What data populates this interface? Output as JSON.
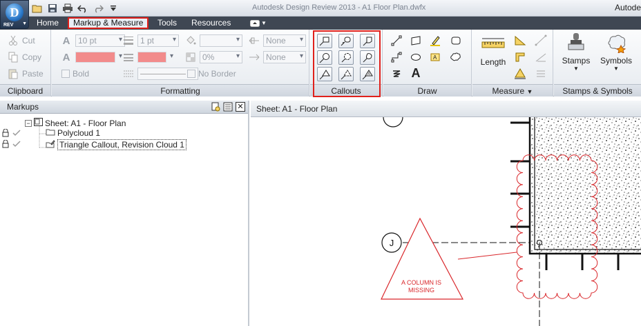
{
  "app": {
    "logo_letter": "D",
    "logo_sub": "REV",
    "title": "Autodesk Design Review 2013 - A1 Floor Plan.dwfx",
    "brand": "Autode"
  },
  "ribbon_tabs": [
    "Home",
    "Markup & Measure",
    "Tools",
    "Resources"
  ],
  "clipboard": {
    "cut": "Cut",
    "copy": "Copy",
    "paste": "Paste",
    "title": "Clipboard"
  },
  "formatting": {
    "font_size": "10 pt",
    "line_weight": "1 pt",
    "transparency": "0%",
    "bold": "Bold",
    "no_border": "No Border",
    "arrow_start": "None",
    "arrow_end": "None",
    "title": "Formatting",
    "fill_color": "#f28b8b",
    "text_color": "#f28b8b"
  },
  "callouts": {
    "title": "Callouts"
  },
  "draw": {
    "title": "Draw",
    "text_icon": "A"
  },
  "measure": {
    "length": "Length",
    "title": "Measure"
  },
  "stamps": {
    "stamps": "Stamps",
    "symbols": "Symbols",
    "title": "Stamps & Symbols"
  },
  "markups_pane": {
    "title": "Markups",
    "close": "✕",
    "items": [
      {
        "label": "Sheet: A1 - Floor Plan"
      },
      {
        "label": "Polycloud 1"
      },
      {
        "label": "Triangle Callout, Revision Cloud 1"
      }
    ]
  },
  "view": {
    "header": "Sheet: A1 - Floor Plan",
    "grid_label": "J",
    "callout_line1": "A COLUMN IS",
    "callout_line2": "MISSING",
    "markup_color": "#d9262a"
  }
}
